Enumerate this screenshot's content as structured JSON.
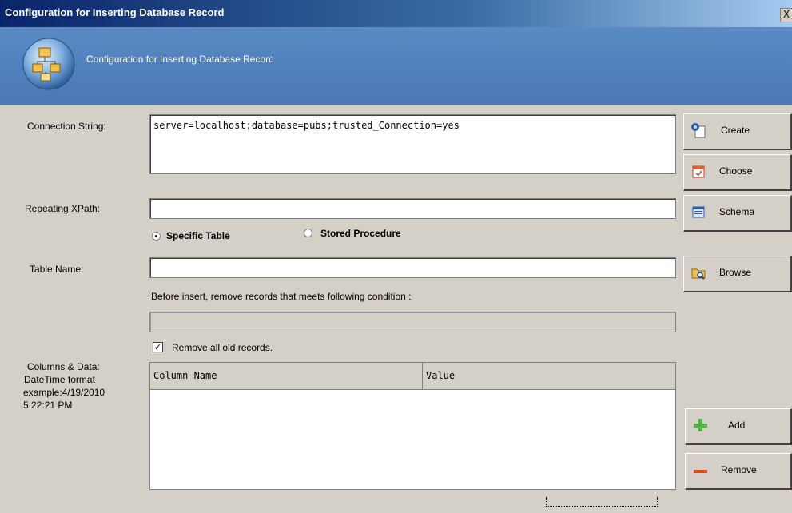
{
  "window": {
    "title": "Configuration for Inserting Database Record",
    "close_glyph": "X"
  },
  "banner": {
    "text": "Configuration for Inserting Database Record",
    "icon": "database-config-icon"
  },
  "connection": {
    "label": "Connection String:",
    "value": "server=localhost;database=pubs;trusted_Connection=yes"
  },
  "xpath": {
    "label": "Repeating XPath:",
    "value": ""
  },
  "mode": {
    "specific_table_label": "Specific Table",
    "stored_procedure_label": "Stored Procedure",
    "selected": "Specific Table"
  },
  "table": {
    "label": "Table Name:",
    "value": ""
  },
  "condition": {
    "label": "Before insert,  remove records that meets following condition :",
    "value": ""
  },
  "remove_all": {
    "label": "Remove all old records.",
    "checked": true
  },
  "columns": {
    "label_line1": "Columns & Data:",
    "label_line2": "DateTime format",
    "label_line3": "example:4/19/2010",
    "label_line4": "5:22:21 PM",
    "headers": [
      "Column Name",
      "Value"
    ],
    "rows": []
  },
  "buttons": {
    "create": "Create",
    "choose": "Choose",
    "schema": "Schema",
    "browse": "Browse",
    "add": "Add",
    "remove": "Remove"
  },
  "colors": {
    "titlebar": "#0a246a",
    "banner": "#4f7fbc",
    "face": "#d4d0c8"
  }
}
